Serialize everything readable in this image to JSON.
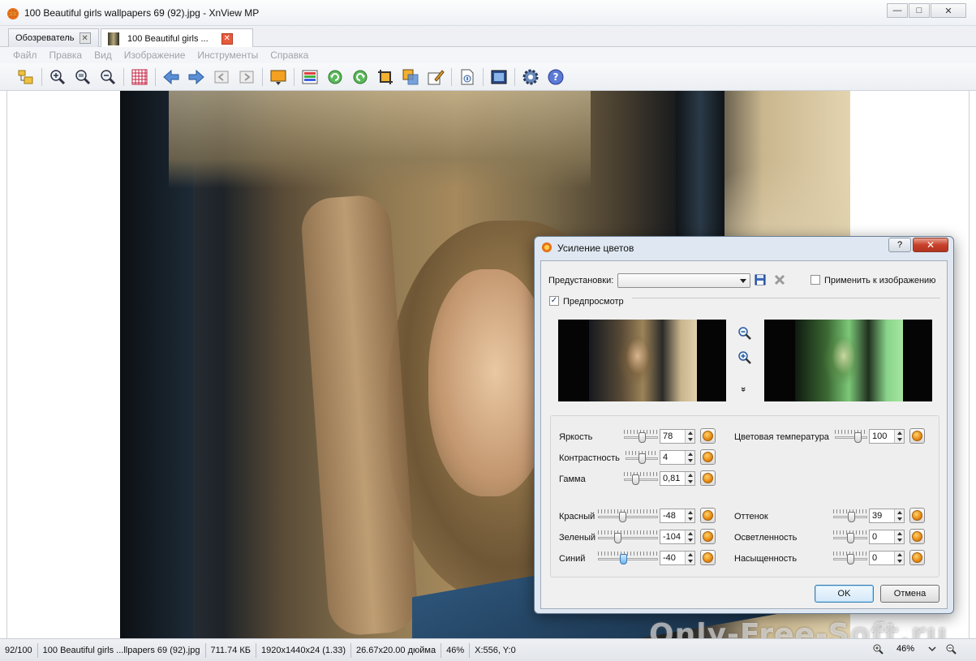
{
  "window": {
    "title": "100 Beautiful girls wallpapers 69 (92).jpg - XnView MP",
    "minimize": "—",
    "maximize": "□",
    "close": "✕"
  },
  "tabs": [
    {
      "label": "Обозреватель",
      "close": "✕"
    },
    {
      "label": "100 Beautiful girls ...",
      "close": "✕"
    }
  ],
  "menu": [
    "Файл",
    "Правка",
    "Вид",
    "Изображение",
    "Инструменты",
    "Справка"
  ],
  "toolbar_icons": [
    "browser-icon",
    "zoom-in-icon",
    "zoom-fit-icon",
    "zoom-out-icon",
    "grid-icon",
    "arrow-left-icon",
    "arrow-right-icon",
    "first-page-icon",
    "last-page-icon",
    "slideshow-icon",
    "adjust-icon",
    "rotate-left-icon",
    "rotate-right-icon",
    "crop-icon",
    "resize-icon",
    "edit-icon",
    "info-icon",
    "fullscreen-icon",
    "settings-icon",
    "help-icon"
  ],
  "status": {
    "index": "92/100",
    "filename": "100 Beautiful girls ...llpapers 69 (92).jpg",
    "filesize": "711.74 КБ",
    "dimensions": "1920x1440x24 (1.33)",
    "print_size": "26.67x20.00 дюйма",
    "zoom": "46%",
    "coords": "X:556, Y:0",
    "zoom_value": "46%"
  },
  "watermark": "Only-Free-Soft.ru",
  "dialog": {
    "title": "Усиление цветов",
    "help": "?",
    "close": "✕",
    "presets_label": "Предустановки:",
    "presets_value": "",
    "apply_label": "Применить к изображению",
    "apply_checked": false,
    "preview_label": "Предпросмотр",
    "preview_checked": true,
    "expand": "»",
    "controls_left": [
      {
        "label": "Яркость",
        "value": "78",
        "pos": 0.55
      },
      {
        "label": "Контрастность",
        "value": "4",
        "pos": 0.5
      },
      {
        "label": "Гамма",
        "value": "0,81",
        "pos": 0.3
      }
    ],
    "controls_rgb": [
      {
        "label": "Красный",
        "value": "-48",
        "pos": 0.4
      },
      {
        "label": "Зеленый",
        "value": "-104",
        "pos": 0.3
      },
      {
        "label": "Синий",
        "value": "-40",
        "pos": 0.42
      }
    ],
    "controls_right_top": {
      "label": "Цветовая температура",
      "value": "100",
      "pos": 0.78
    },
    "controls_right": [
      {
        "label": "Оттенок",
        "value": "39",
        "pos": 0.55
      },
      {
        "label": "Осветленность",
        "value": "0",
        "pos": 0.5
      },
      {
        "label": "Насыщенность",
        "value": "0",
        "pos": 0.5
      }
    ],
    "ok": "OK",
    "cancel": "Отмена"
  }
}
